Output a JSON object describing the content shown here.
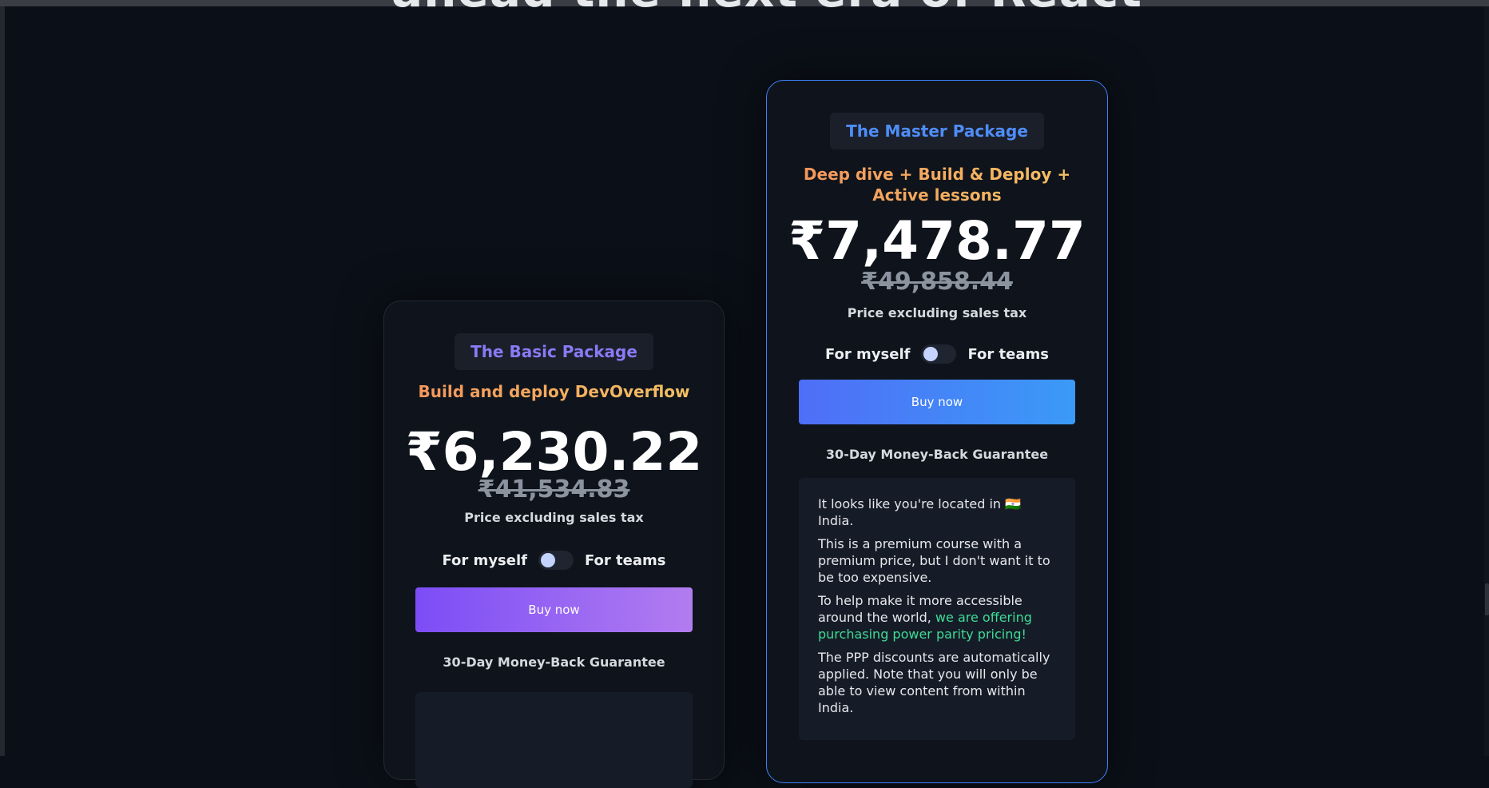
{
  "headline": "ahead the next era of React",
  "colors": {
    "background": "#0b0f17",
    "card": "#0f141c",
    "master_border": "#3b82f6",
    "basic_badge_text": "#8b79f5",
    "master_badge_text": "#4f8df6",
    "accent_green": "#3ddc97"
  },
  "basic": {
    "badge": "The Basic Package",
    "subtitle": "Build and deploy DevOverflow",
    "price": "₹6,230.22",
    "old_price": "₹41,534.83",
    "tax_note": "Price excluding sales tax",
    "toggle_left": "For myself",
    "toggle_right": "For teams",
    "buy_label": "Buy now",
    "guarantee": "30-Day Money-Back Guarantee"
  },
  "master": {
    "badge": "The Master Package",
    "subtitle_line1": "Deep dive + Build & Deploy +",
    "subtitle_line2": "Active lessons",
    "price": "₹7,478.77",
    "old_price": "₹49,858.44",
    "tax_note": "Price excluding sales tax",
    "toggle_left": "For myself",
    "toggle_right": "For teams",
    "buy_label": "Buy now",
    "guarantee": "30-Day Money-Back Guarantee",
    "info": {
      "location_prefix": "It looks like you're located in",
      "flag": "🇮🇳",
      "country": "India.",
      "para1": "This is a premium course with a premium price, but I don't want it to be too expensive.",
      "para2_prefix": "To help make it more accessible around the world,",
      "para2_highlight": "we are offering purchasing power parity pricing!",
      "para3": "The PPP discounts are automatically applied. Note that you will only be able to view content from within India."
    }
  }
}
